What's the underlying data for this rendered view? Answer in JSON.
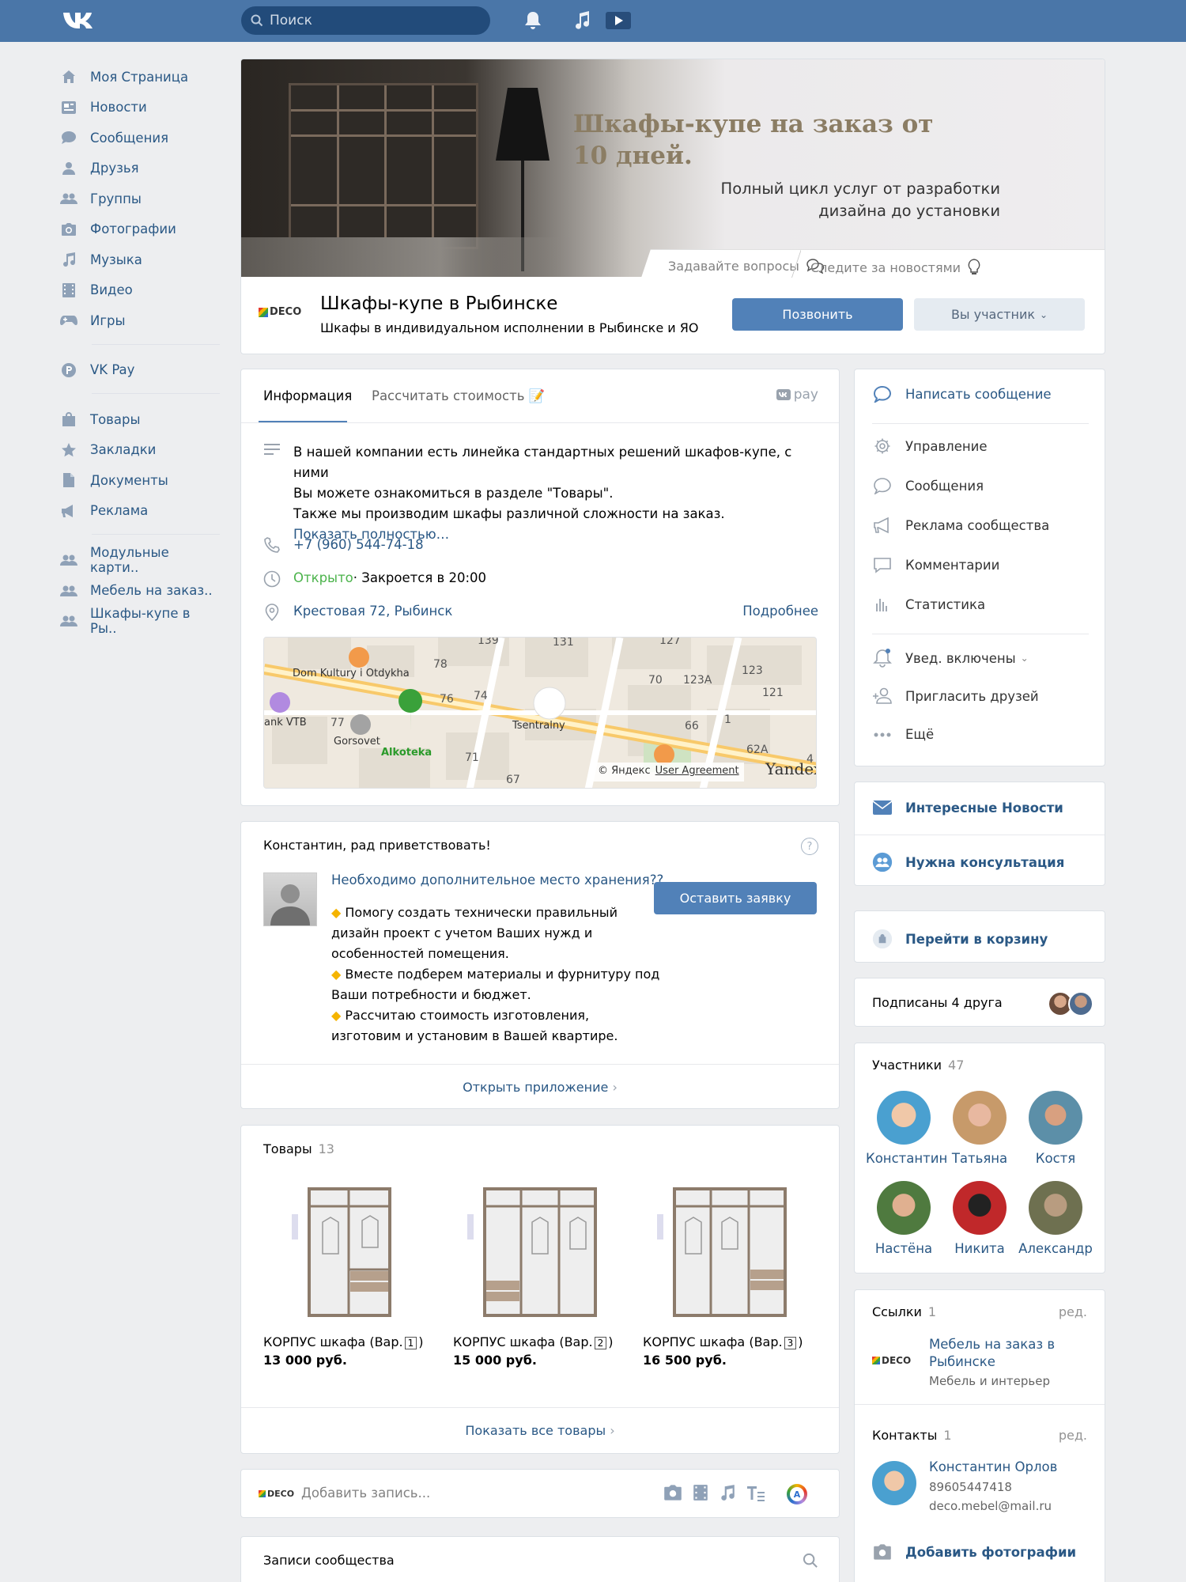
{
  "header": {
    "search_placeholder": "Поиск"
  },
  "leftnav": {
    "main": [
      {
        "label": "Моя Страница",
        "icon": "home-icon"
      },
      {
        "label": "Новости",
        "icon": "news-icon"
      },
      {
        "label": "Сообщения",
        "icon": "messages-icon"
      },
      {
        "label": "Друзья",
        "icon": "friend-icon"
      },
      {
        "label": "Группы",
        "icon": "groups-icon"
      },
      {
        "label": "Фотографии",
        "icon": "camera-icon"
      },
      {
        "label": "Музыка",
        "icon": "music-icon"
      },
      {
        "label": "Видео",
        "icon": "video-icon"
      },
      {
        "label": "Игры",
        "icon": "gamepad-icon"
      }
    ],
    "pay": {
      "label": "VK Pay",
      "icon": "vkpay-icon"
    },
    "extra": [
      {
        "label": "Товары",
        "icon": "bag-icon"
      },
      {
        "label": "Закладки",
        "icon": "star-icon"
      },
      {
        "label": "Документы",
        "icon": "document-icon"
      },
      {
        "label": "Реклама",
        "icon": "megaphone-icon"
      }
    ],
    "groups": [
      {
        "label": "Модульные карти..",
        "icon": "groups-icon"
      },
      {
        "label": "Мебель на заказ..",
        "icon": "groups-icon"
      },
      {
        "label": "Шкафы-купе в Ры..",
        "icon": "groups-icon"
      }
    ]
  },
  "cover": {
    "title": "Шкафы-купе на заказ от 10 дней.",
    "subtitle": "Полный цикл услуг от разработки дизайна до установки",
    "tab_questions": "Задавайте вопросы",
    "tab_news": "Следите за новостями"
  },
  "group": {
    "logo_text": "DECO",
    "name": "Шкафы-купе в Рыбинске",
    "description": "Шкафы в индивидуальном исполнении в Рыбинске и ЯО",
    "call_button": "Позвонить",
    "member_button": "Вы участник"
  },
  "info": {
    "tab_info": "Информация",
    "tab_calc": "Рассчитать стоимость 📝",
    "pay_label": "pay",
    "description_l1": "В нашей компании есть линейка стандартных решений шкафов-купе, с ними",
    "description_l2": "Вы можете ознакомиться в разделе \"Товары\".",
    "description_l3": "Также мы производим шкафы различной сложности на заказ.",
    "show_more": "Показать полностью…",
    "phone": "+7 (960) 544-74-18",
    "open_status": "Открыто",
    "hours": " · Закроется в 20:00",
    "address": "Крестовая 72, Рыбинск",
    "details": "Подробнее",
    "map_labels": {
      "dom": "Dom Kultury i Otdykha",
      "bank": "ank VTB",
      "gorsovet": "Gorsovet",
      "alkoteka": "Alkoteka",
      "tsentralny": "Tsentralny",
      "copyright": "© Яндекс",
      "agreement": "User Agreement",
      "yandex": "Yandex",
      "n139": "139",
      "n131": "131",
      "n127": "127",
      "n78": "78",
      "n70": "70",
      "n123a": "123А",
      "n123": "123",
      "n76": "76",
      "n74": "74",
      "n121": "121",
      "n77": "77",
      "n66": "66",
      "n1": "1",
      "n71": "71",
      "n62a": "62A",
      "n67": "67",
      "n4": "4"
    }
  },
  "welcome": {
    "greeting": "Константин, рад приветствовать!",
    "headline": "Необходимо дополнительное место хранения??",
    "cta": "Оставить заявку",
    "b1_l1": "Помогу создать технически правильный",
    "b1_l2": "дизайн проект с учетом Ваших нужд и",
    "b1_l3": "особенностей помещения.",
    "b2_l1": "Вместе подберем материалы и фурнитуру под",
    "b2_l2": "Ваши потребности и бюджет.",
    "b3_l1": "Рассчитаю стоимость изготовления,",
    "b3_l2": "изготовим и установим в Вашей квартире.",
    "open_app": "Открыть приложение"
  },
  "goods": {
    "title": "Товары",
    "count": "13",
    "items": [
      {
        "name_prefix": "КОРПУС шкафа (Вар.",
        "num": "1",
        "name_suffix": ")",
        "price": "13 000 руб."
      },
      {
        "name_prefix": "КОРПУС шкафа (Вар.",
        "num": "2",
        "name_suffix": ")",
        "price": "15 000 руб."
      },
      {
        "name_prefix": "КОРПУС шкафа (Вар.",
        "num": "3",
        "name_suffix": ")",
        "price": "16 500 руб."
      }
    ],
    "show_all": "Показать все товары"
  },
  "post": {
    "placeholder": "Добавить запись..."
  },
  "wall": {
    "title": "Записи сообщества"
  },
  "rmenu": {
    "write": "Написать сообщение",
    "manage": "Управление",
    "messages": "Сообщения",
    "ads": "Реклама сообщества",
    "comments": "Комментарии",
    "stats": "Статистика",
    "notify": "Увед. включены",
    "invite": "Пригласить друзей",
    "more": "Ещё"
  },
  "links_menu": {
    "news": "Интересные Новости",
    "consult": "Нужна консультация"
  },
  "cart": {
    "label": "Перейти в корзину"
  },
  "friends": {
    "label": "Подписаны 4 друга"
  },
  "members": {
    "title": "Участники",
    "count": "47",
    "list": [
      {
        "name": "Константин"
      },
      {
        "name": "Татьяна"
      },
      {
        "name": "Костя"
      },
      {
        "name": "Настёна"
      },
      {
        "name": "Никита"
      },
      {
        "name": "Александр"
      }
    ]
  },
  "links": {
    "title": "Ссылки",
    "count": "1",
    "edit": "ред.",
    "item_title_l1": "Мебель на заказ в",
    "item_title_l2": "Рыбинске",
    "item_sub": "Мебель и интерьер",
    "logo_text": "DECO"
  },
  "contacts": {
    "title": "Контакты",
    "count": "1",
    "edit": "ред.",
    "name": "Константин Орлов",
    "phone": "89605447418",
    "email": "deco.mebel@mail.ru"
  },
  "photos": {
    "add": "Добавить фотографии"
  },
  "colors": {
    "header": "#4a76a8",
    "link": "#2a5885",
    "button": "#5181b8",
    "open": "#4bb34b"
  }
}
